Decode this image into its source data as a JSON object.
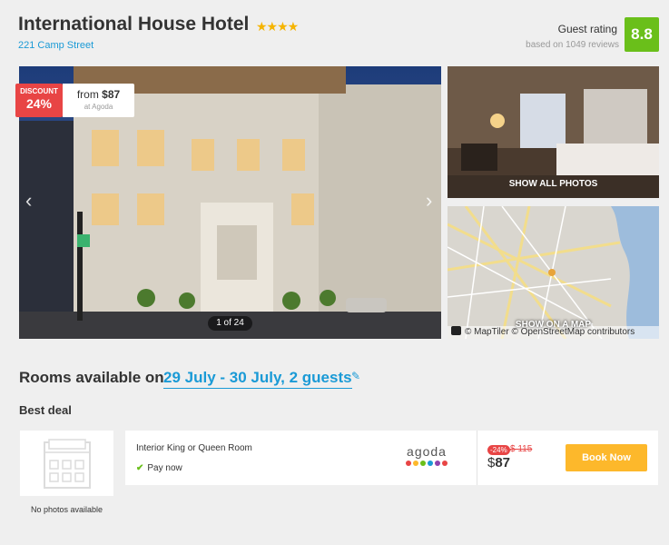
{
  "hotel": {
    "name": "International House Hotel",
    "stars": "★★★★",
    "address": "221 Camp Street"
  },
  "rating": {
    "label": "Guest rating",
    "reviews": "based on 1049 reviews",
    "score": "8.8"
  },
  "gallery": {
    "discount_label": "DISCOUNT",
    "discount_value": "24%",
    "from_prefix": "from ",
    "from_price": "$87",
    "from_source": "at Agoda",
    "counter": "1 of 24",
    "prev_arrow": "‹",
    "next_arrow": "›",
    "show_all": "SHOW ALL PHOTOS",
    "show_map": "SHOW ON A MAP",
    "map_attribution": "© MapTiler © OpenStreetMap contributors"
  },
  "rooms": {
    "title": "Rooms available on",
    "dates": "29 July - 30 July, 2 guests",
    "edit_icon": "✎"
  },
  "best_deal": {
    "heading": "Best deal",
    "no_photo": "No photos available",
    "room_name": "Interior King or Queen Room",
    "pay_check": "✔",
    "pay_label": "Pay now",
    "provider": "agoda",
    "provider_dot_colors": [
      "#e84545",
      "#fdb82b",
      "#6abf1a",
      "#1a9ad6",
      "#8e44ad",
      "#e84545"
    ],
    "discount": "-24%",
    "old_price": "$ 115",
    "currency": "$",
    "price": "87",
    "book_label": "Book Now"
  },
  "colors": {
    "accent": "#1a9ad6",
    "rating": "#6abf1a",
    "discount": "#e84545",
    "book": "#fdb82b"
  }
}
